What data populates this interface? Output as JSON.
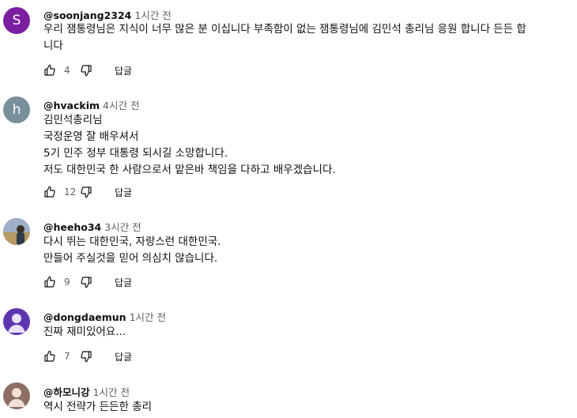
{
  "comments": [
    {
      "author": "@soonjang2324",
      "time": "1시간 전",
      "avatar_letter": "S",
      "avatar_color": "#7b1fa2",
      "text": "우리 잼통령님은 지식이 너무 많은 분 이십니다 부족함이 없는 잼통령님에 김민석 총리님 응원 합니다 든든 합\n니다",
      "likes": "4",
      "reply_label": "답글"
    },
    {
      "author": "@hvackim",
      "time": "4시간 전",
      "avatar_letter": "h",
      "avatar_color": "#78909c",
      "text": "김민석총리님\n국정운영 잘 배우셔서\n5기 민주 정부 대통령 되시길 소망합니다.\n저도 대한민국 한 사람으로서 맡은바 책임을 다하고 배우겠습니다.",
      "likes": "12",
      "reply_label": "답글"
    },
    {
      "author": "@heeho34",
      "time": "3시간 전",
      "avatar_letter": "",
      "avatar_color": "#8a94a6",
      "text": "다시 뛰는 대한민국, 자랑스런 대한민국.\n만들어 주실것을 믿어 의심치 않습니다.",
      "likes": "9",
      "reply_label": "답글"
    },
    {
      "author": "@dongdaemun",
      "time": "1시간 전",
      "avatar_letter": "",
      "avatar_color": "#5e35b1",
      "text": "진짜 재미있어요...",
      "likes": "7",
      "reply_label": "답글"
    },
    {
      "author": "@하모니강",
      "time": "1시간 전",
      "avatar_letter": "",
      "avatar_color": "#8d6e63",
      "text": "역시 전략가  든든한 총리",
      "likes": "",
      "reply_label": ""
    }
  ]
}
